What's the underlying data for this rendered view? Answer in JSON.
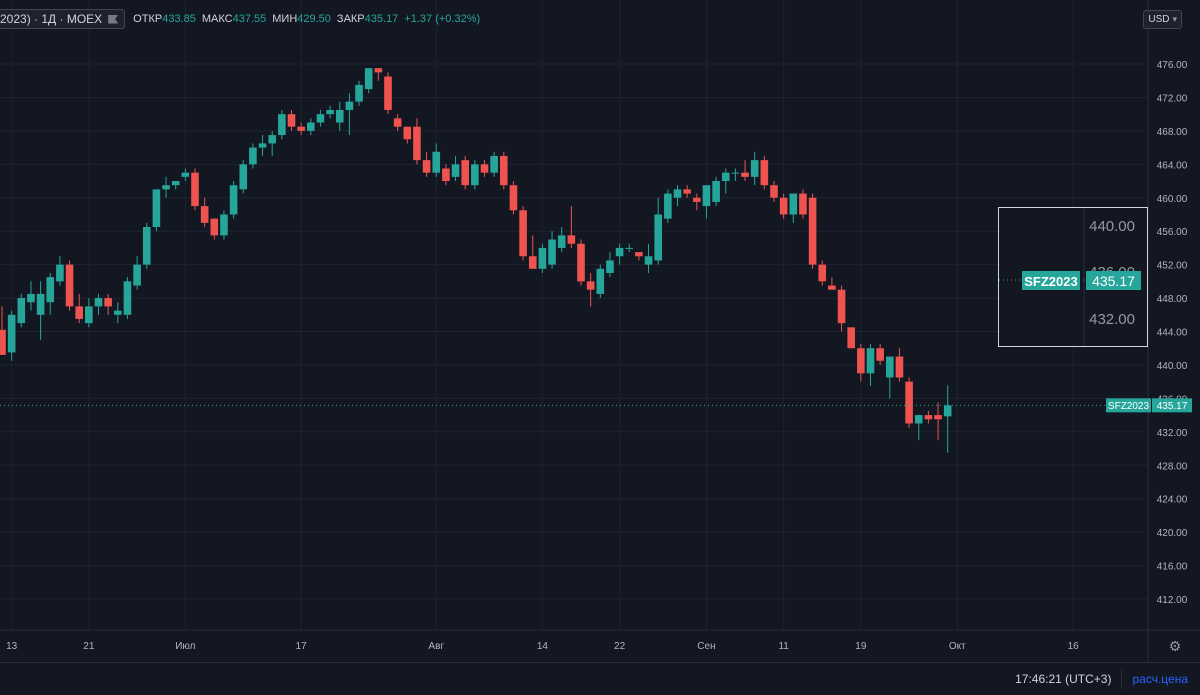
{
  "legend": {
    "symbol_fragment": "2023) · 1Д · MOEX",
    "open_label": "ОТКР",
    "open_value": "433.85",
    "high_label": "МАКС",
    "high_value": "437.55",
    "low_label": "МИН",
    "low_value": "429.50",
    "close_label": "ЗАКР",
    "close_value": "435.17",
    "change": "+1.37 (+0.32%)"
  },
  "currency": "USD",
  "price_tag": {
    "symbol": "SFZ2023",
    "value": "435.17"
  },
  "zoom_box": {
    "ticks": [
      "440.00",
      "436.00",
      "432.00"
    ],
    "symbol": "SFZ2023",
    "value": "435.17"
  },
  "bottom": {
    "time": "17:46:21 (UTC+3)",
    "scale_label": "расч.цена"
  },
  "colors": {
    "up": "#26a69a",
    "down": "#ef5350",
    "bg": "#131722",
    "grid": "#1f2330"
  },
  "chart_data": {
    "type": "candlestick",
    "ylim": [
      408,
      478
    ],
    "y_ticks": [
      412,
      416,
      420,
      424,
      428,
      432,
      436,
      440,
      444,
      448,
      452,
      456,
      460,
      464,
      468,
      472,
      476
    ],
    "x_tick_labels": [
      "13",
      "21",
      "Июл",
      "17",
      "Авг",
      "14",
      "22",
      "Сен",
      "11",
      "19",
      "Окт",
      "16"
    ],
    "candles": [
      {
        "o": 444.2,
        "h": 447.0,
        "l": 442.0,
        "c": 441.2
      },
      {
        "o": 441.5,
        "h": 446.5,
        "l": 440.5,
        "c": 446.0
      },
      {
        "o": 445.0,
        "h": 448.5,
        "l": 444.5,
        "c": 448.0
      },
      {
        "o": 447.5,
        "h": 450.0,
        "l": 446.5,
        "c": 448.5
      },
      {
        "o": 446.0,
        "h": 450.0,
        "l": 443.0,
        "c": 448.5
      },
      {
        "o": 447.5,
        "h": 451.0,
        "l": 446.0,
        "c": 450.5
      },
      {
        "o": 450.0,
        "h": 453.0,
        "l": 449.5,
        "c": 452.0
      },
      {
        "o": 452.0,
        "h": 452.5,
        "l": 446.5,
        "c": 447.0
      },
      {
        "o": 447.0,
        "h": 448.5,
        "l": 445.0,
        "c": 445.5
      },
      {
        "o": 445.0,
        "h": 448.0,
        "l": 444.5,
        "c": 447.0
      },
      {
        "o": 447.0,
        "h": 448.5,
        "l": 446.0,
        "c": 448.0
      },
      {
        "o": 448.0,
        "h": 448.5,
        "l": 446.0,
        "c": 447.0
      },
      {
        "o": 446.0,
        "h": 447.5,
        "l": 445.0,
        "c": 446.5
      },
      {
        "o": 446.0,
        "h": 450.5,
        "l": 445.5,
        "c": 450.0
      },
      {
        "o": 449.5,
        "h": 453.0,
        "l": 449.0,
        "c": 452.0
      },
      {
        "o": 452.0,
        "h": 457.0,
        "l": 451.5,
        "c": 456.5
      },
      {
        "o": 456.5,
        "h": 461.0,
        "l": 456.0,
        "c": 461.0
      },
      {
        "o": 461.0,
        "h": 462.5,
        "l": 460.0,
        "c": 461.5
      },
      {
        "o": 461.5,
        "h": 462.0,
        "l": 461.0,
        "c": 462.0
      },
      {
        "o": 462.5,
        "h": 463.5,
        "l": 462.0,
        "c": 463.0
      },
      {
        "o": 463.0,
        "h": 463.5,
        "l": 458.5,
        "c": 459.0
      },
      {
        "o": 459.0,
        "h": 460.0,
        "l": 456.5,
        "c": 457.0
      },
      {
        "o": 457.5,
        "h": 457.5,
        "l": 455.0,
        "c": 455.5
      },
      {
        "o": 455.5,
        "h": 458.5,
        "l": 455.0,
        "c": 458.0
      },
      {
        "o": 458.0,
        "h": 462.0,
        "l": 457.5,
        "c": 461.5
      },
      {
        "o": 461.0,
        "h": 464.5,
        "l": 460.5,
        "c": 464.0
      },
      {
        "o": 464.0,
        "h": 466.5,
        "l": 463.5,
        "c": 466.0
      },
      {
        "o": 466.0,
        "h": 467.5,
        "l": 465.0,
        "c": 466.5
      },
      {
        "o": 466.5,
        "h": 468.0,
        "l": 465.0,
        "c": 467.5
      },
      {
        "o": 467.5,
        "h": 470.5,
        "l": 467.0,
        "c": 470.0
      },
      {
        "o": 470.0,
        "h": 470.5,
        "l": 468.0,
        "c": 468.5
      },
      {
        "o": 468.5,
        "h": 469.0,
        "l": 467.5,
        "c": 468.0
      },
      {
        "o": 468.0,
        "h": 469.5,
        "l": 467.5,
        "c": 469.0
      },
      {
        "o": 469.0,
        "h": 470.5,
        "l": 468.5,
        "c": 470.0
      },
      {
        "o": 470.0,
        "h": 471.0,
        "l": 469.5,
        "c": 470.5
      },
      {
        "o": 469.0,
        "h": 471.5,
        "l": 468.0,
        "c": 470.5
      },
      {
        "o": 470.5,
        "h": 472.5,
        "l": 467.5,
        "c": 471.5
      },
      {
        "o": 471.5,
        "h": 474.0,
        "l": 471.0,
        "c": 473.5
      },
      {
        "o": 473.0,
        "h": 475.5,
        "l": 472.5,
        "c": 475.5
      },
      {
        "o": 475.5,
        "h": 475.5,
        "l": 474.0,
        "c": 475.0
      },
      {
        "o": 474.5,
        "h": 475.0,
        "l": 470.0,
        "c": 470.5
      },
      {
        "o": 469.5,
        "h": 470.0,
        "l": 468.0,
        "c": 468.5
      },
      {
        "o": 468.5,
        "h": 468.5,
        "l": 466.5,
        "c": 467.0
      },
      {
        "o": 468.5,
        "h": 469.5,
        "l": 464.0,
        "c": 464.5
      },
      {
        "o": 464.5,
        "h": 465.5,
        "l": 462.5,
        "c": 463.0
      },
      {
        "o": 463.0,
        "h": 466.5,
        "l": 462.5,
        "c": 465.5
      },
      {
        "o": 463.5,
        "h": 464.0,
        "l": 461.5,
        "c": 462.0
      },
      {
        "o": 462.5,
        "h": 465.0,
        "l": 462.0,
        "c": 464.0
      },
      {
        "o": 464.5,
        "h": 465.0,
        "l": 461.0,
        "c": 461.5
      },
      {
        "o": 461.5,
        "h": 464.5,
        "l": 461.0,
        "c": 464.0
      },
      {
        "o": 464.0,
        "h": 464.5,
        "l": 462.5,
        "c": 463.0
      },
      {
        "o": 463.0,
        "h": 465.5,
        "l": 462.5,
        "c": 465.0
      },
      {
        "o": 465.0,
        "h": 465.5,
        "l": 461.0,
        "c": 461.5
      },
      {
        "o": 461.5,
        "h": 462.0,
        "l": 458.0,
        "c": 458.5
      },
      {
        "o": 458.5,
        "h": 459.0,
        "l": 452.5,
        "c": 453.0
      },
      {
        "o": 453.0,
        "h": 455.5,
        "l": 451.5,
        "c": 451.5
      },
      {
        "o": 451.5,
        "h": 454.5,
        "l": 451.0,
        "c": 454.0
      },
      {
        "o": 452.0,
        "h": 456.0,
        "l": 451.5,
        "c": 455.0
      },
      {
        "o": 454.0,
        "h": 456.5,
        "l": 453.5,
        "c": 455.5
      },
      {
        "o": 455.5,
        "h": 459.0,
        "l": 454.0,
        "c": 454.5
      },
      {
        "o": 454.5,
        "h": 455.0,
        "l": 449.5,
        "c": 450.0
      },
      {
        "o": 450.0,
        "h": 451.0,
        "l": 447.0,
        "c": 449.0
      },
      {
        "o": 448.5,
        "h": 452.0,
        "l": 448.0,
        "c": 451.5
      },
      {
        "o": 451.0,
        "h": 453.5,
        "l": 450.5,
        "c": 452.5
      },
      {
        "o": 453.0,
        "h": 454.5,
        "l": 452.0,
        "c": 454.0
      },
      {
        "o": 454.0,
        "h": 454.5,
        "l": 453.5,
        "c": 454.0
      },
      {
        "o": 453.5,
        "h": 453.5,
        "l": 452.5,
        "c": 453.0
      },
      {
        "o": 452.0,
        "h": 454.5,
        "l": 451.0,
        "c": 453.0
      },
      {
        "o": 452.5,
        "h": 460.0,
        "l": 452.0,
        "c": 458.0
      },
      {
        "o": 457.5,
        "h": 461.0,
        "l": 457.0,
        "c": 460.5
      },
      {
        "o": 460.0,
        "h": 461.5,
        "l": 459.0,
        "c": 461.0
      },
      {
        "o": 461.0,
        "h": 461.5,
        "l": 460.0,
        "c": 460.5
      },
      {
        "o": 460.0,
        "h": 460.5,
        "l": 458.5,
        "c": 459.5
      },
      {
        "o": 459.0,
        "h": 461.0,
        "l": 457.5,
        "c": 461.5
      },
      {
        "o": 459.5,
        "h": 462.5,
        "l": 459.0,
        "c": 462.0
      },
      {
        "o": 462.0,
        "h": 463.5,
        "l": 460.5,
        "c": 463.0
      },
      {
        "o": 463.0,
        "h": 463.5,
        "l": 462.0,
        "c": 463.0
      },
      {
        "o": 463.0,
        "h": 464.5,
        "l": 462.0,
        "c": 462.5
      },
      {
        "o": 462.5,
        "h": 465.5,
        "l": 461.5,
        "c": 464.5
      },
      {
        "o": 464.5,
        "h": 465.0,
        "l": 461.0,
        "c": 461.5
      },
      {
        "o": 461.5,
        "h": 462.0,
        "l": 459.5,
        "c": 460.0
      },
      {
        "o": 460.0,
        "h": 460.5,
        "l": 457.5,
        "c": 458.0
      },
      {
        "o": 458.0,
        "h": 460.5,
        "l": 457.0,
        "c": 460.5
      },
      {
        "o": 460.5,
        "h": 461.0,
        "l": 457.5,
        "c": 458.0
      },
      {
        "o": 460.0,
        "h": 460.5,
        "l": 451.5,
        "c": 452.0
      },
      {
        "o": 452.0,
        "h": 452.5,
        "l": 449.5,
        "c": 450.0
      },
      {
        "o": 449.5,
        "h": 450.5,
        "l": 449.0,
        "c": 449.0
      },
      {
        "o": 449.0,
        "h": 449.5,
        "l": 444.0,
        "c": 445.0
      },
      {
        "o": 444.5,
        "h": 444.5,
        "l": 442.0,
        "c": 442.0
      },
      {
        "o": 442.0,
        "h": 442.5,
        "l": 438.0,
        "c": 439.0
      },
      {
        "o": 439.0,
        "h": 442.5,
        "l": 437.5,
        "c": 442.0
      },
      {
        "o": 442.0,
        "h": 442.5,
        "l": 440.0,
        "c": 440.5
      },
      {
        "o": 438.5,
        "h": 440.5,
        "l": 436.0,
        "c": 441.0
      },
      {
        "o": 441.0,
        "h": 442.0,
        "l": 438.0,
        "c": 438.5
      },
      {
        "o": 438.0,
        "h": 438.5,
        "l": 432.5,
        "c": 433.0
      },
      {
        "o": 433.0,
        "h": 434.0,
        "l": 431.0,
        "c": 434.0
      },
      {
        "o": 434.0,
        "h": 434.5,
        "l": 433.0,
        "c": 433.5
      },
      {
        "o": 434.0,
        "h": 435.5,
        "l": 431.0,
        "c": 433.5
      },
      {
        "o": 433.85,
        "h": 437.55,
        "l": 429.5,
        "c": 435.17
      }
    ]
  }
}
